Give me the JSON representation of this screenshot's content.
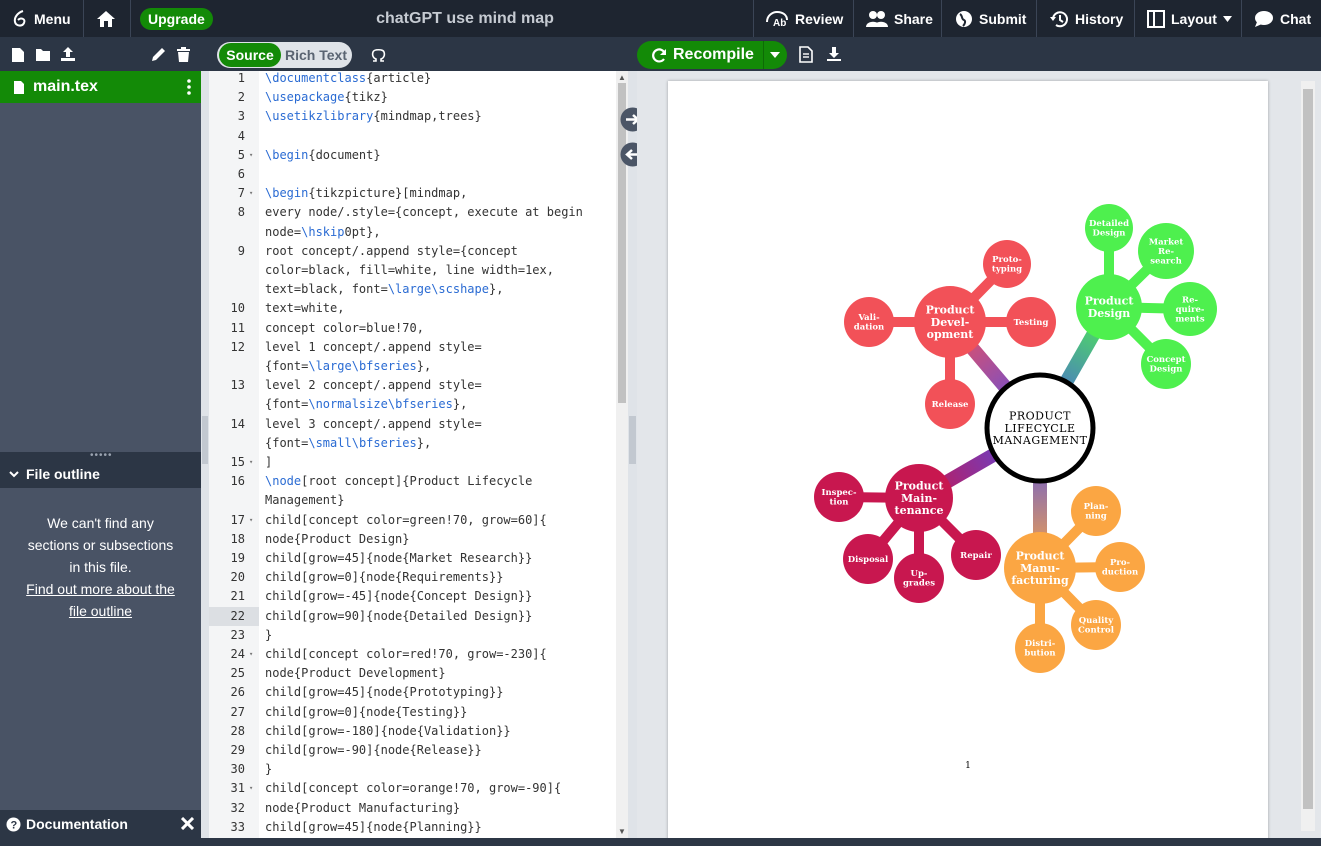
{
  "topbar": {
    "menu_label": "Menu",
    "upgrade_label": "Upgrade",
    "title": "chatGPT use mind map",
    "review_label": "Review",
    "share_label": "Share",
    "submit_label": "Submit",
    "history_label": "History",
    "layout_label": "Layout",
    "chat_label": "Chat"
  },
  "editor_toolbar": {
    "source_label": "Source",
    "rich_text_label": "Rich Text",
    "recompile_label": "Recompile"
  },
  "sidebar": {
    "active_file": "main.tex",
    "outline_title": "File outline",
    "outline_message": "We can't find any sections or subsections in this file.",
    "outline_link": "Find out more about the file outline",
    "documentation_label": "Documentation"
  },
  "code_lines": [
    {
      "n": "1",
      "fold": false,
      "text": "\\documentclass{article}"
    },
    {
      "n": "2",
      "fold": false,
      "text": "\\usepackage{tikz}"
    },
    {
      "n": "3",
      "fold": false,
      "text": "\\usetikzlibrary{mindmap,trees}"
    },
    {
      "n": "4",
      "fold": false,
      "text": ""
    },
    {
      "n": "5",
      "fold": true,
      "text": "\\begin{document}"
    },
    {
      "n": "6",
      "fold": false,
      "text": ""
    },
    {
      "n": "7",
      "fold": true,
      "text": "\\begin{tikzpicture}[mindmap,"
    },
    {
      "n": "8",
      "fold": false,
      "text": "every node/.style={concept, execute at begin"
    },
    {
      "n": "",
      "fold": false,
      "text": "node=\\hskip0pt},"
    },
    {
      "n": "9",
      "fold": false,
      "text": "root concept/.append style={concept"
    },
    {
      "n": "",
      "fold": false,
      "text": "color=black, fill=white, line width=1ex,"
    },
    {
      "n": "",
      "fold": false,
      "text": "text=black, font=\\large\\scshape},"
    },
    {
      "n": "10",
      "fold": false,
      "text": "text=white,"
    },
    {
      "n": "11",
      "fold": false,
      "text": "concept color=blue!70,"
    },
    {
      "n": "12",
      "fold": false,
      "text": "level 1 concept/.append style="
    },
    {
      "n": "",
      "fold": false,
      "text": "{font=\\large\\bfseries},"
    },
    {
      "n": "13",
      "fold": false,
      "text": "level 2 concept/.append style="
    },
    {
      "n": "",
      "fold": false,
      "text": "{font=\\normalsize\\bfseries},"
    },
    {
      "n": "14",
      "fold": false,
      "text": "level 3 concept/.append style="
    },
    {
      "n": "",
      "fold": false,
      "text": "{font=\\small\\bfseries},"
    },
    {
      "n": "15",
      "fold": true,
      "text": "]"
    },
    {
      "n": "16",
      "fold": false,
      "text": "\\node[root concept]{Product Lifecycle"
    },
    {
      "n": "",
      "fold": false,
      "text": "Management}"
    },
    {
      "n": "17",
      "fold": true,
      "text": "child[concept color=green!70, grow=60]{"
    },
    {
      "n": "18",
      "fold": false,
      "text": "node{Product Design}"
    },
    {
      "n": "19",
      "fold": false,
      "text": "child[grow=45]{node{Market Research}}"
    },
    {
      "n": "20",
      "fold": false,
      "text": "child[grow=0]{node{Requirements}}"
    },
    {
      "n": "21",
      "fold": false,
      "text": "child[grow=-45]{node{Concept Design}}"
    },
    {
      "n": "22",
      "fold": false,
      "text": "child[grow=90]{node{Detailed Design}}"
    },
    {
      "n": "23",
      "fold": false,
      "text": "}"
    },
    {
      "n": "24",
      "fold": true,
      "text": "child[concept color=red!70, grow=-230]{"
    },
    {
      "n": "25",
      "fold": false,
      "text": "node{Product Development}"
    },
    {
      "n": "26",
      "fold": false,
      "text": "child[grow=45]{node{Prototyping}}"
    },
    {
      "n": "27",
      "fold": false,
      "text": "child[grow=0]{node{Testing}}"
    },
    {
      "n": "28",
      "fold": false,
      "text": "child[grow=-180]{node{Validation}}"
    },
    {
      "n": "29",
      "fold": false,
      "text": "child[grow=-90]{node{Release}}"
    },
    {
      "n": "30",
      "fold": false,
      "text": "}"
    },
    {
      "n": "31",
      "fold": true,
      "text": "child[concept color=orange!70, grow=-90]{"
    },
    {
      "n": "32",
      "fold": false,
      "text": "node{Product Manufacturing}"
    },
    {
      "n": "33",
      "fold": false,
      "text": "child[grow=45]{node{Planning}}"
    }
  ],
  "pdf": {
    "page_number": "1",
    "root": [
      "Product",
      "Lifecycle",
      "Management"
    ],
    "colors": {
      "green": "#4ef04e",
      "red": "#f25158",
      "orange": "#fba643",
      "crimson": "#c8174f",
      "blue": "#4a4ef0"
    },
    "design": {
      "main": [
        "Product",
        "Design"
      ],
      "children": [
        [
          "Detailed",
          "Design"
        ],
        [
          "Market",
          "Re-",
          "search"
        ],
        [
          "Re-",
          "quire-",
          "ments"
        ],
        [
          "Concept",
          "Design"
        ]
      ]
    },
    "development": {
      "main": [
        "Product",
        "Devel-",
        "opment"
      ],
      "children": [
        [
          "Proto-",
          "typing"
        ],
        [
          "Testing"
        ],
        [
          "Vali-",
          "dation"
        ],
        [
          "Release"
        ]
      ]
    },
    "maintenance": {
      "main": [
        "Product",
        "Main-",
        "tenance"
      ],
      "children": [
        [
          "Inspec-",
          "tion"
        ],
        [
          "Disposal"
        ],
        [
          "Up-",
          "grades"
        ],
        [
          "Repair"
        ]
      ]
    },
    "manufacturing": {
      "main": [
        "Product",
        "Manu-",
        "facturing"
      ],
      "children": [
        [
          "Plan-",
          "ning"
        ],
        [
          "Pro-",
          "duction"
        ],
        [
          "Quality",
          "Control"
        ],
        [
          "Distri-",
          "bution"
        ]
      ]
    }
  }
}
